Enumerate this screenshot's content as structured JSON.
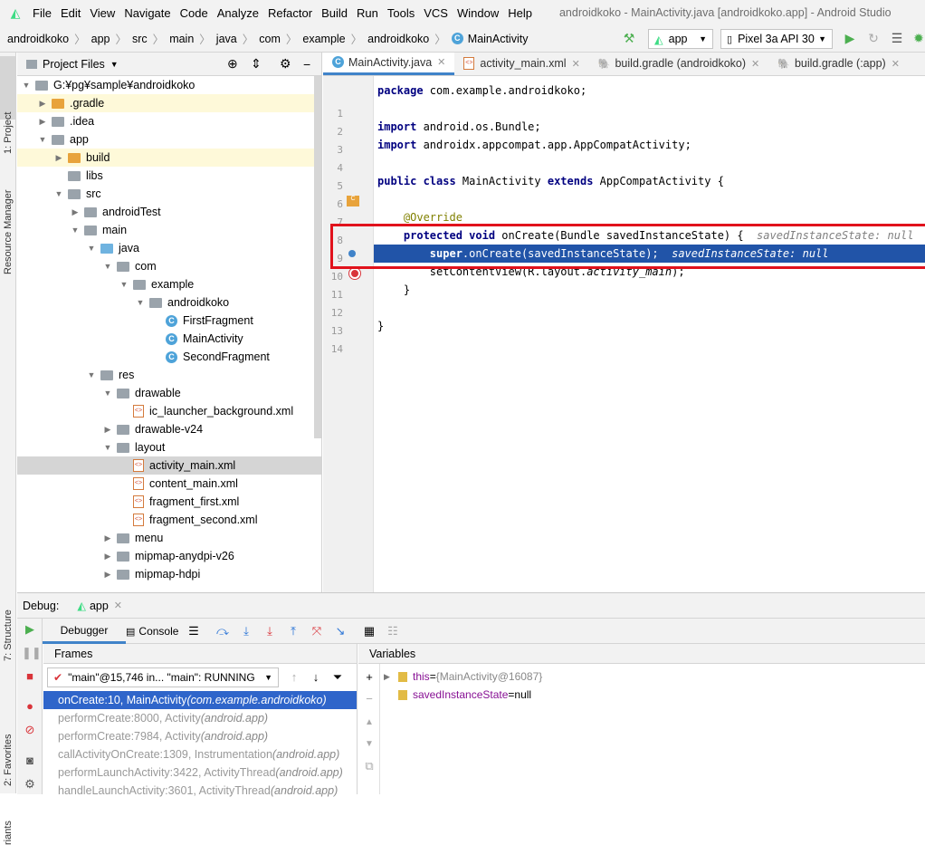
{
  "menubar": {
    "items": [
      "File",
      "Edit",
      "View",
      "Navigate",
      "Code",
      "Analyze",
      "Refactor",
      "Build",
      "Run",
      "Tools",
      "VCS",
      "Window",
      "Help"
    ],
    "window_title": "androidkoko - MainActivity.java [androidkoko.app] - Android Studio"
  },
  "breadcrumb": [
    "androidkoko",
    "app",
    "src",
    "main",
    "java",
    "com",
    "example",
    "androidkoko",
    "MainActivity"
  ],
  "toolbar": {
    "run_config": "app",
    "device": "Pixel 3a API 30"
  },
  "left_tools": {
    "project": "1: Project",
    "resource_manager": "Resource Manager",
    "structure": "7: Structure",
    "favorites": "2: Favorites",
    "variants": "riants"
  },
  "project_panel": {
    "title": "Project Files",
    "tree": [
      {
        "label": "G:¥pg¥sample¥androidkoko",
        "depth": 0,
        "arrow": "▼",
        "icon": "gray",
        "bold": true
      },
      {
        "label": ".gradle",
        "depth": 1,
        "arrow": "▶",
        "icon": "orange",
        "mod": true
      },
      {
        "label": ".idea",
        "depth": 1,
        "arrow": "▶",
        "icon": "gray"
      },
      {
        "label": "app",
        "depth": 1,
        "arrow": "▼",
        "icon": "gray"
      },
      {
        "label": "build",
        "depth": 2,
        "arrow": "▶",
        "icon": "orange",
        "mod": true
      },
      {
        "label": "libs",
        "depth": 2,
        "arrow": "",
        "icon": "gray"
      },
      {
        "label": "src",
        "depth": 2,
        "arrow": "▼",
        "icon": "gray"
      },
      {
        "label": "androidTest",
        "depth": 3,
        "arrow": "▶",
        "icon": "gray"
      },
      {
        "label": "main",
        "depth": 3,
        "arrow": "▼",
        "icon": "gray"
      },
      {
        "label": "java",
        "depth": 4,
        "arrow": "▼",
        "icon": "blue"
      },
      {
        "label": "com",
        "depth": 5,
        "arrow": "▼",
        "icon": "gray"
      },
      {
        "label": "example",
        "depth": 6,
        "arrow": "▼",
        "icon": "gray"
      },
      {
        "label": "androidkoko",
        "depth": 7,
        "arrow": "▼",
        "icon": "gray"
      },
      {
        "label": "FirstFragment",
        "depth": 8,
        "arrow": "",
        "icon": "class"
      },
      {
        "label": "MainActivity",
        "depth": 8,
        "arrow": "",
        "icon": "class"
      },
      {
        "label": "SecondFragment",
        "depth": 8,
        "arrow": "",
        "icon": "class"
      },
      {
        "label": "res",
        "depth": 4,
        "arrow": "▼",
        "icon": "res"
      },
      {
        "label": "drawable",
        "depth": 5,
        "arrow": "▼",
        "icon": "gray"
      },
      {
        "label": "ic_launcher_background.xml",
        "depth": 6,
        "arrow": "",
        "icon": "xml"
      },
      {
        "label": "drawable-v24",
        "depth": 5,
        "arrow": "▶",
        "icon": "gray"
      },
      {
        "label": "layout",
        "depth": 5,
        "arrow": "▼",
        "icon": "gray"
      },
      {
        "label": "activity_main.xml",
        "depth": 6,
        "arrow": "",
        "icon": "xml",
        "selected": true
      },
      {
        "label": "content_main.xml",
        "depth": 6,
        "arrow": "",
        "icon": "xml"
      },
      {
        "label": "fragment_first.xml",
        "depth": 6,
        "arrow": "",
        "icon": "xml"
      },
      {
        "label": "fragment_second.xml",
        "depth": 6,
        "arrow": "",
        "icon": "xml"
      },
      {
        "label": "menu",
        "depth": 5,
        "arrow": "▶",
        "icon": "gray"
      },
      {
        "label": "mipmap-anydpi-v26",
        "depth": 5,
        "arrow": "▶",
        "icon": "gray"
      },
      {
        "label": "mipmap-hdpi",
        "depth": 5,
        "arrow": "▶",
        "icon": "gray"
      }
    ]
  },
  "editor": {
    "tabs": [
      {
        "label": "MainActivity.java",
        "active": true
      },
      {
        "label": "activity_main.xml",
        "active": false
      },
      {
        "label": "build.gradle (androidkoko)",
        "active": false
      },
      {
        "label": "build.gradle (:app)",
        "active": false
      }
    ],
    "lines": [
      {
        "n": "1",
        "html": "<span class='kw'>package</span> com.example.androidkoko;"
      },
      {
        "n": "2",
        "html": ""
      },
      {
        "n": "3",
        "html": "<span class='kw'>import</span> android.os.Bundle;"
      },
      {
        "n": "4",
        "html": "<span class='kw'>import</span> androidx.appcompat.app.AppCompatActivity;"
      },
      {
        "n": "5",
        "html": ""
      },
      {
        "n": "6",
        "html": "<span class='kw'>public class</span> MainActivity <span class='kw'>extends</span> AppCompatActivity {"
      },
      {
        "n": "7",
        "html": ""
      },
      {
        "n": "8",
        "html": "    <span class='ann'>@Override</span>"
      },
      {
        "n": "9",
        "html": "    <span class='kw'>protected void</span> onCreate(Bundle savedInstanceState) {  <span class='hint'>savedInstanceState: null</span>"
      },
      {
        "n": "10",
        "html": "        <b>super</b>.onCreate(savedInstanceState);  <i>savedInstanceState: null</i>",
        "current": true
      },
      {
        "n": "11",
        "html": "        setContentView(R.layout.<i>activity_main</i>);"
      },
      {
        "n": "12",
        "html": "    }"
      },
      {
        "n": "13",
        "html": ""
      },
      {
        "n": "14",
        "html": "}"
      }
    ]
  },
  "debug": {
    "label": "Debug:",
    "session": "app",
    "tab_debugger": "Debugger",
    "tab_console": "Console",
    "frames_title": "Frames",
    "variables_title": "Variables",
    "thread": "\"main\"@15,746 in... \"main\": RUNNING",
    "frames": [
      {
        "method": "onCreate:10, MainActivity ",
        "pkg": "(com.example.androidkoko)",
        "selected": true
      },
      {
        "method": "performCreate:8000, Activity ",
        "pkg": "(android.app)"
      },
      {
        "method": "performCreate:7984, Activity ",
        "pkg": "(android.app)"
      },
      {
        "method": "callActivityOnCreate:1309, Instrumentation ",
        "pkg": "(android.app)"
      },
      {
        "method": "performLaunchActivity:3422, ActivityThread ",
        "pkg": "(android.app)"
      },
      {
        "method": "handleLaunchActivity:3601, ActivityThread ",
        "pkg": "(android.app)"
      }
    ],
    "variables": [
      {
        "name": "this",
        "value": "{MainActivity@16087}",
        "expandable": true
      },
      {
        "name": "savedInstanceState",
        "value": "null",
        "expandable": false
      }
    ]
  },
  "colors": {
    "highlight": "#e1121c",
    "selection": "#2154a8",
    "frame_selection": "#2f65ca"
  }
}
